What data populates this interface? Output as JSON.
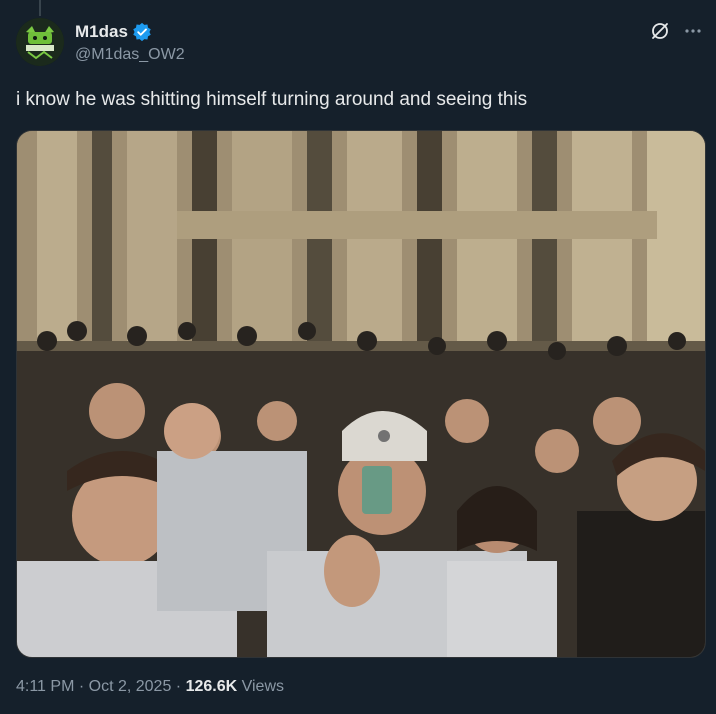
{
  "author": {
    "display_name": "M1das",
    "handle": "@M1das_OW2",
    "verified": true,
    "verified_color": "#1d9bf0",
    "avatar_icon": "avatar-image"
  },
  "header": {
    "grok_icon": "grok-icon",
    "more_icon": "more-options-icon"
  },
  "tweet": {
    "text": "i know he was shitting himself turning around and seeing this"
  },
  "media": {
    "type": "video",
    "description_icon": "video-thumbnail"
  },
  "meta": {
    "time": "4:11 PM",
    "separator1": " · ",
    "date": "Oct 2, 2025",
    "separator2": " · ",
    "views_count": "126.6K",
    "views_label": " Views"
  },
  "colors": {
    "background": "#15202b",
    "text_primary": "#e7e9ea",
    "text_secondary": "#8b98a5",
    "accent": "#1d9bf0"
  }
}
